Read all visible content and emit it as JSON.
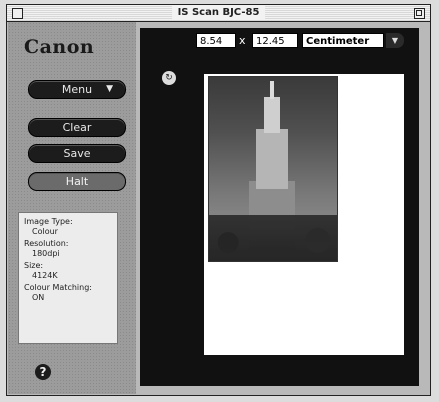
{
  "window": {
    "title": "IS Scan BJC-85"
  },
  "sidebar": {
    "logo": "Canon",
    "menu_label": "Menu",
    "clear_label": "Clear",
    "save_label": "Save",
    "halt_label": "Halt",
    "help_label": "?"
  },
  "info": {
    "image_type_label": "Image Type:",
    "image_type_value": "Colour",
    "resolution_label": "Resolution:",
    "resolution_value": "180dpi",
    "size_label": "Size:",
    "size_value": "4124K",
    "colour_matching_label": "Colour Matching:",
    "colour_matching_value": "ON"
  },
  "toolbar": {
    "width_value": "8.54",
    "x_label": "x",
    "height_value": "12.45",
    "unit_selected": "Centimeter"
  },
  "icons": {
    "menu_arrow": "chevron-down-icon",
    "unit_arrow": "chevron-down-icon",
    "rotate": "rotate-icon",
    "help": "help-icon"
  }
}
